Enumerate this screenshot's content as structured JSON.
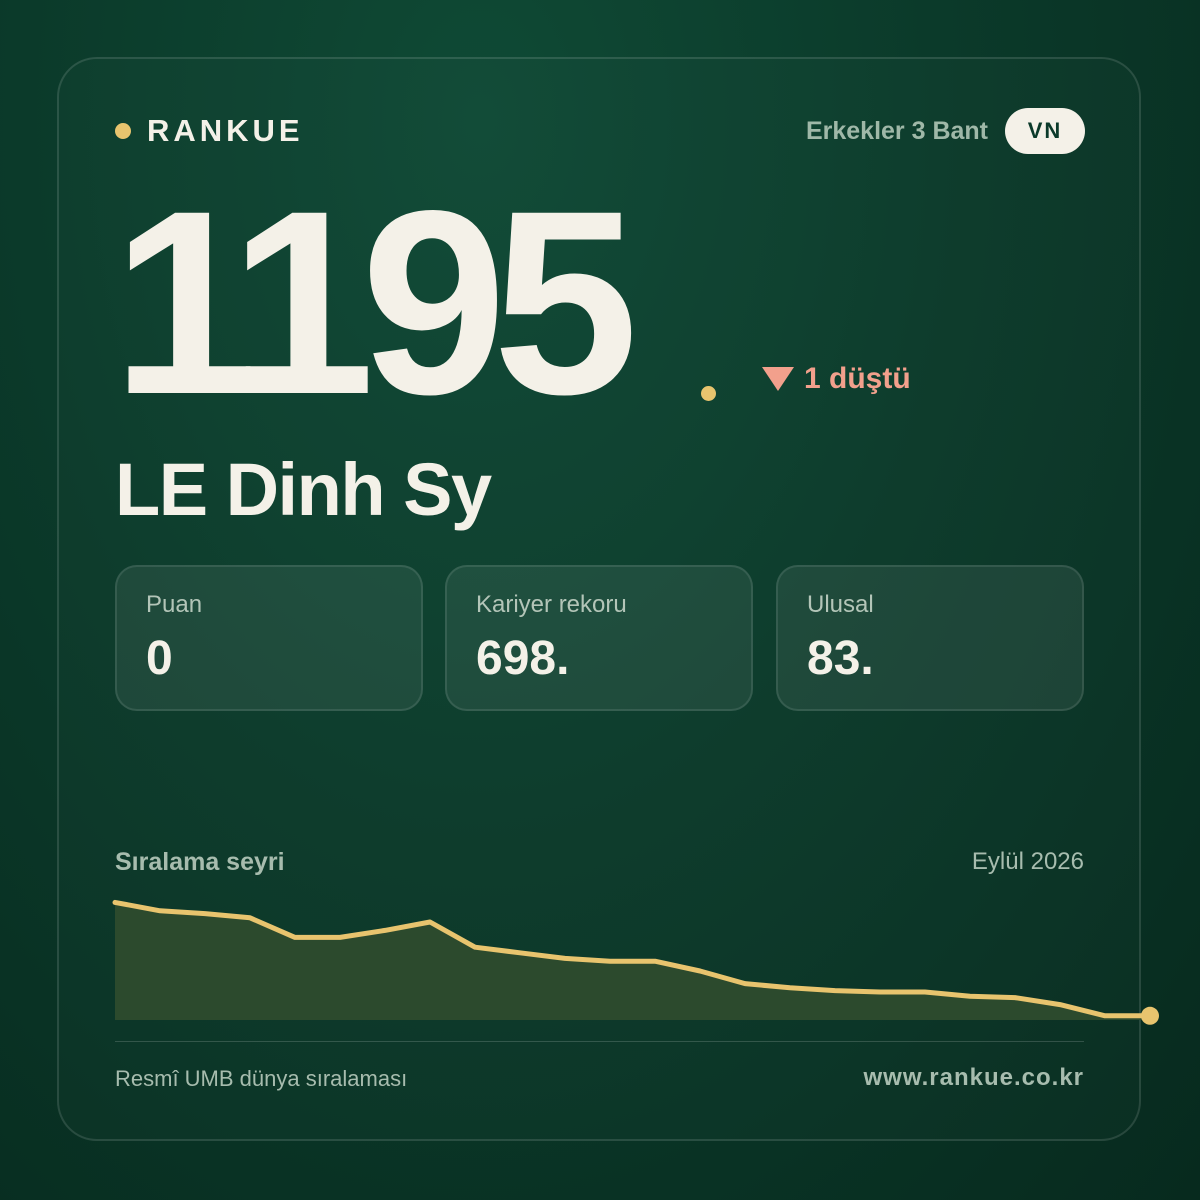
{
  "brand": {
    "name": "RANKUE"
  },
  "header": {
    "category": "Erkekler 3 Bant",
    "country_code": "VN"
  },
  "rank": {
    "value": "1195",
    "change": "1 düştü"
  },
  "player": {
    "name": "LE Dinh Sy"
  },
  "stats": [
    {
      "label": "Puan",
      "value": "0"
    },
    {
      "label": "Kariyer rekoru",
      "value": "698."
    },
    {
      "label": "Ulusal",
      "value": "83."
    }
  ],
  "chart_data": {
    "type": "area",
    "title": "Sıralama seyri",
    "period_label": "Eylül 2026",
    "x": [
      1,
      2,
      3,
      4,
      5,
      6,
      7,
      8,
      9,
      10,
      11,
      12,
      13,
      14,
      15,
      16,
      17,
      18,
      19,
      20,
      21,
      22,
      23,
      24
    ],
    "values": [
      0.84,
      0.78,
      0.76,
      0.73,
      0.59,
      0.59,
      0.64,
      0.7,
      0.52,
      0.48,
      0.44,
      0.42,
      0.42,
      0.35,
      0.26,
      0.23,
      0.21,
      0.2,
      0.2,
      0.17,
      0.16,
      0.11,
      0.03,
      0.03
    ],
    "ylim": [
      0,
      1
    ],
    "grid": false,
    "colors": {
      "line": "#e8c46e",
      "fill": "#2c4a2d",
      "end_marker": "#e8c46e"
    }
  },
  "footer": {
    "source": "Resmî UMB dünya sıralaması",
    "url": "www.rankue.co.kr"
  }
}
